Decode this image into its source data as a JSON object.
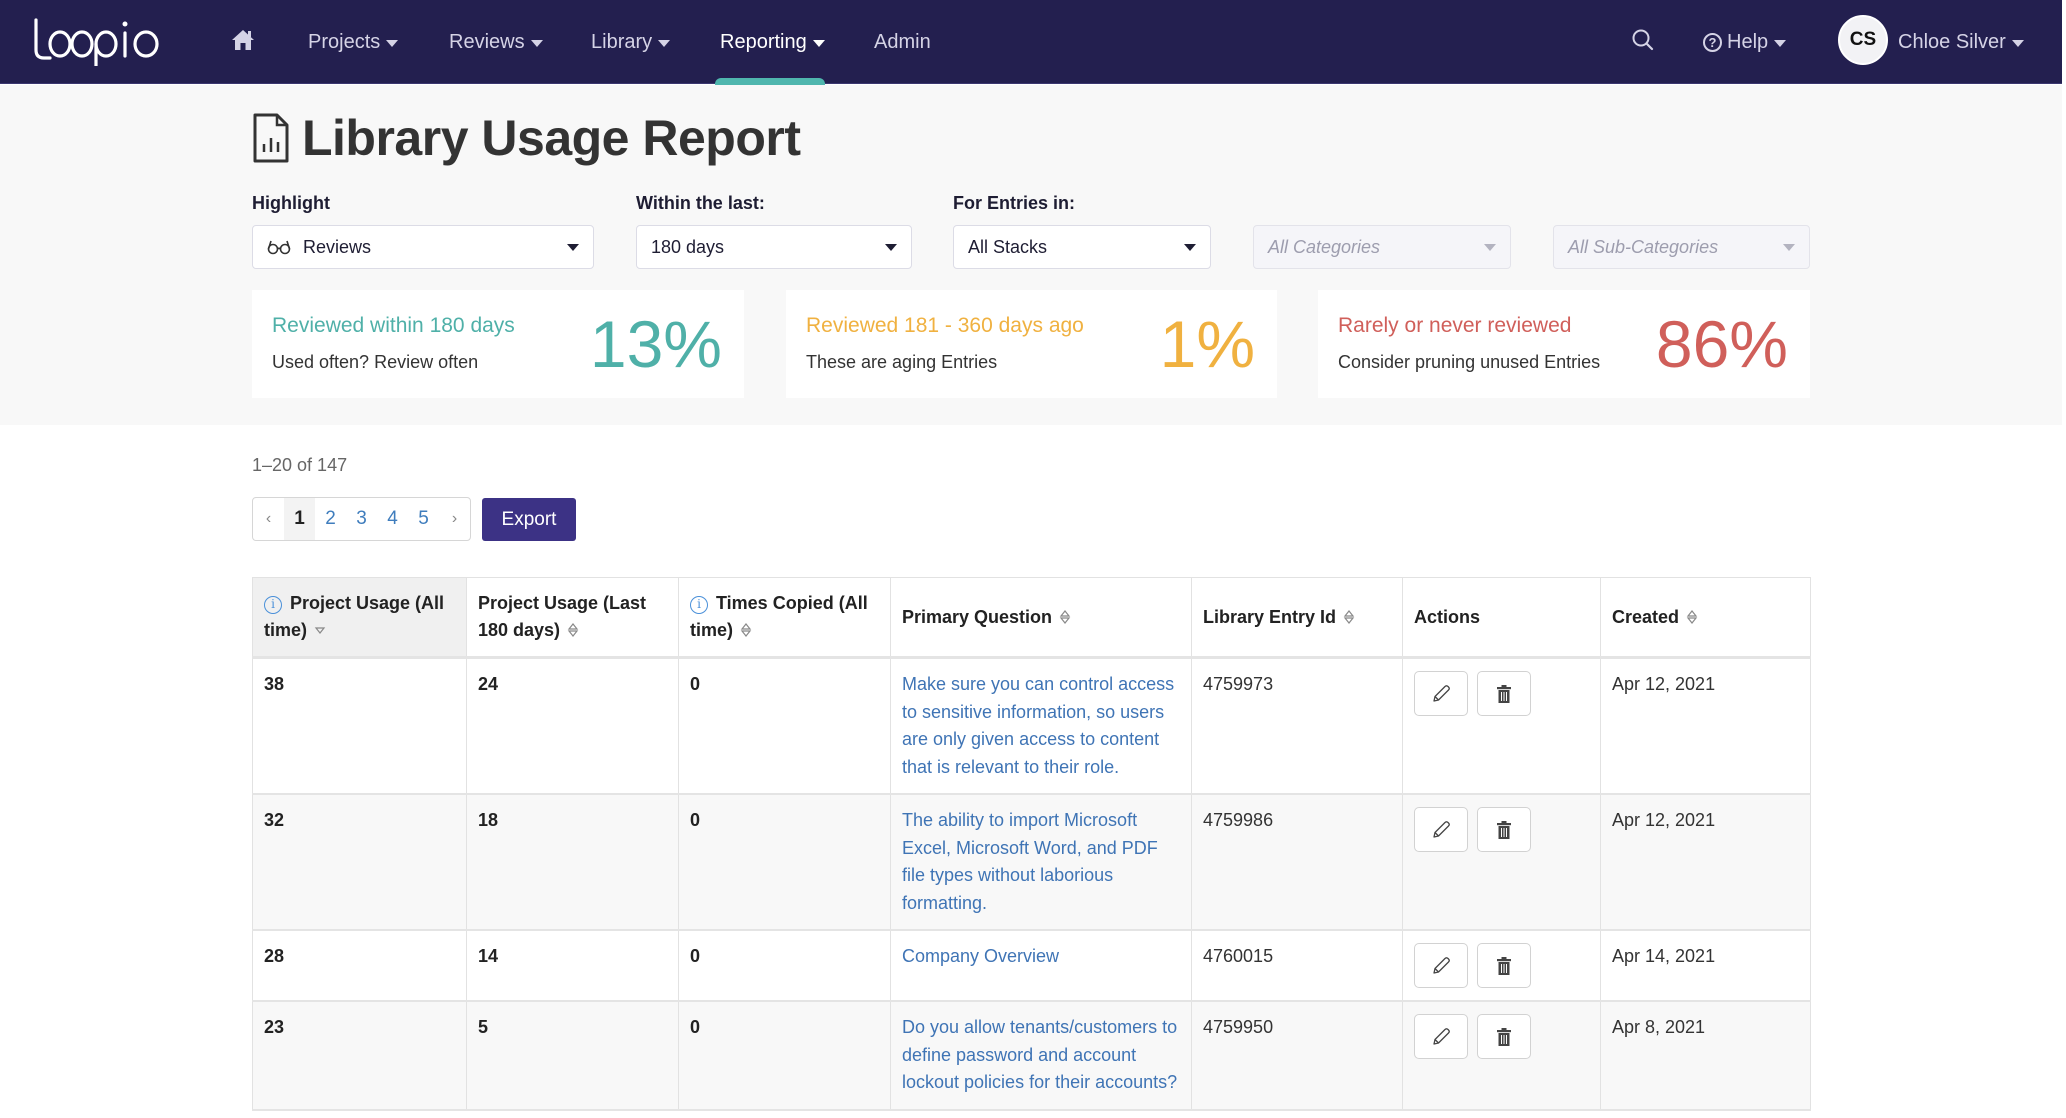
{
  "nav": {
    "logo": "loopio",
    "items": [
      {
        "label": "Projects",
        "dropdown": true
      },
      {
        "label": "Reviews",
        "dropdown": true
      },
      {
        "label": "Library",
        "dropdown": true
      },
      {
        "label": "Reporting",
        "dropdown": true,
        "active": true
      },
      {
        "label": "Admin",
        "dropdown": false
      }
    ],
    "help_label": "Help",
    "user": {
      "initials": "CS",
      "name": "Chloe Silver"
    }
  },
  "page": {
    "title": "Library Usage Report"
  },
  "filters": {
    "highlight": {
      "label": "Highlight",
      "value": "Reviews"
    },
    "within": {
      "label": "Within the last:",
      "value": "180 days"
    },
    "entries": {
      "label": "For Entries in:",
      "stack": "All Stacks",
      "categories_placeholder": "All Categories",
      "subcategories_placeholder": "All Sub-Categories"
    }
  },
  "stats": [
    {
      "title": "Reviewed within 180 days",
      "desc": "Used often? Review often",
      "value": "13%",
      "color": "#4fb0a8"
    },
    {
      "title": "Reviewed 181 - 360 days ago",
      "desc": "These are aging Entries",
      "value": "1%",
      "color": "#f0b140"
    },
    {
      "title": "Rarely or never reviewed",
      "desc": "Consider pruning unused Entries",
      "value": "86%",
      "color": "#d05f5a"
    }
  ],
  "results": {
    "range": "1–20 of 147",
    "pages": [
      "1",
      "2",
      "3",
      "4",
      "5"
    ],
    "current_page": "1",
    "prev": "‹",
    "next": "›",
    "export_label": "Export"
  },
  "table": {
    "columns": [
      {
        "label": "Project Usage (All time)",
        "info": true,
        "sort": "desc"
      },
      {
        "label": "Project Usage (Last 180 days)",
        "info": false,
        "sort": "both"
      },
      {
        "label": "Times Copied (All time)",
        "info": true,
        "sort": "both"
      },
      {
        "label": "Primary Question",
        "info": false,
        "sort": "both"
      },
      {
        "label": "Library Entry Id",
        "info": false,
        "sort": "both"
      },
      {
        "label": "Actions",
        "info": false,
        "sort": "none"
      },
      {
        "label": "Created",
        "info": false,
        "sort": "both"
      }
    ],
    "rows": [
      {
        "usage_all": "38",
        "usage_180": "24",
        "copied": "0",
        "question": "Make sure you can control access to sensitive information, so users are only given access to content that is relevant to their role.",
        "entry_id": "4759973",
        "created": "Apr 12, 2021"
      },
      {
        "usage_all": "32",
        "usage_180": "18",
        "copied": "0",
        "question": "The ability to import Microsoft Excel, Microsoft Word, and PDF file types without laborious formatting.",
        "entry_id": "4759986",
        "created": "Apr 12, 2021"
      },
      {
        "usage_all": "28",
        "usage_180": "14",
        "copied": "0",
        "question": "Company Overview",
        "entry_id": "4760015",
        "created": "Apr 14, 2021"
      },
      {
        "usage_all": "23",
        "usage_180": "5",
        "copied": "0",
        "question": "Do you allow tenants/customers to define password and account lockout policies for their accounts?",
        "entry_id": "4759950",
        "created": "Apr 8, 2021"
      }
    ]
  }
}
